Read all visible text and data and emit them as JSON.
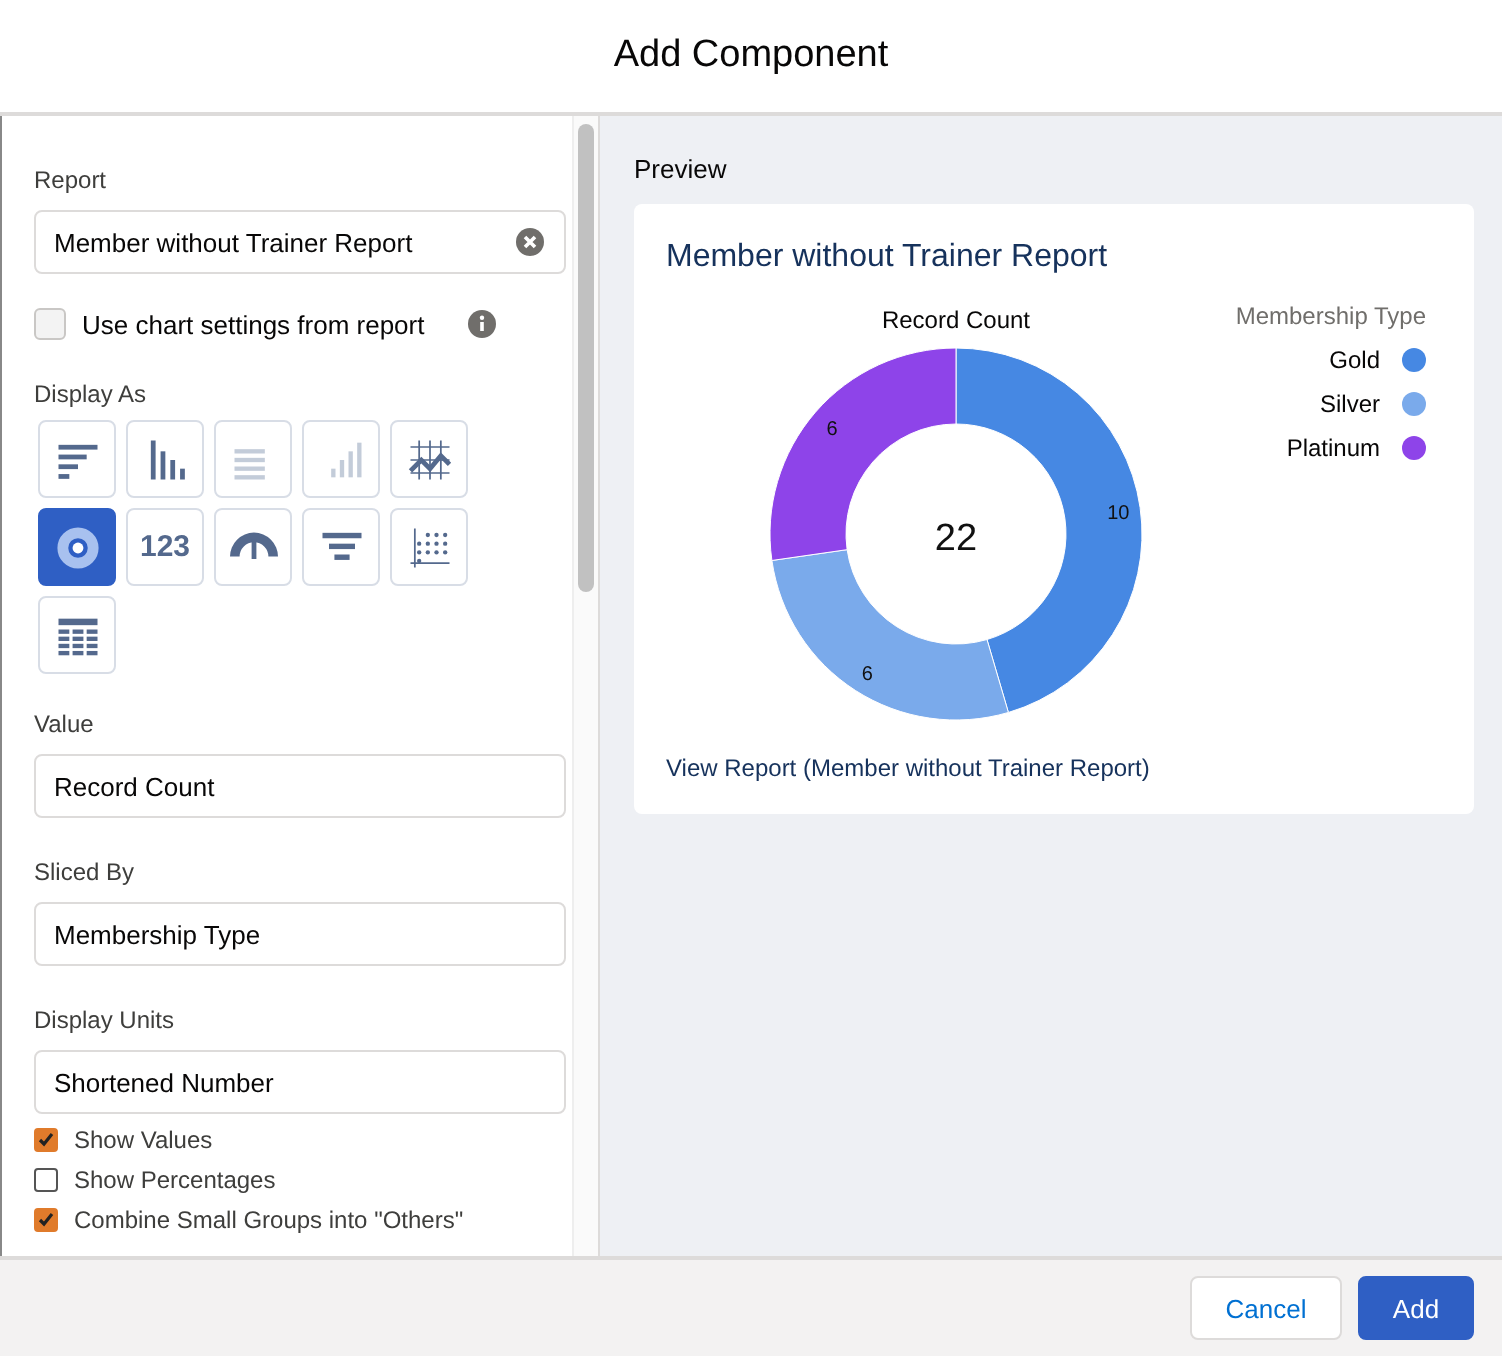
{
  "window": {
    "title": "Add Component"
  },
  "settings": {
    "report": {
      "label": "Report",
      "value": "Member without Trainer Report"
    },
    "use_chart_settings": {
      "label": "Use chart settings from report",
      "checked": false
    },
    "display_as": {
      "label": "Display As",
      "options": [
        {
          "kind": "bar-horizontal",
          "selected": false,
          "disabled": false
        },
        {
          "kind": "bar-vertical",
          "selected": false,
          "disabled": false
        },
        {
          "kind": "stacked-horizontal",
          "selected": false,
          "disabled": true
        },
        {
          "kind": "stacked-vertical",
          "selected": false,
          "disabled": true
        },
        {
          "kind": "line",
          "selected": false,
          "disabled": false
        },
        {
          "kind": "donut",
          "selected": true,
          "disabled": false
        },
        {
          "kind": "metric",
          "selected": false,
          "disabled": false,
          "text": "123"
        },
        {
          "kind": "gauge",
          "selected": false,
          "disabled": false
        },
        {
          "kind": "funnel",
          "selected": false,
          "disabled": false
        },
        {
          "kind": "scatter",
          "selected": false,
          "disabled": false
        },
        {
          "kind": "table",
          "selected": false,
          "disabled": false
        }
      ]
    },
    "fields": [
      {
        "label": "Value",
        "value": "Record Count"
      },
      {
        "label": "Sliced By",
        "value": "Membership Type"
      },
      {
        "label": "Display Units",
        "value": "Shortened Number"
      }
    ],
    "options": [
      {
        "label": "Show Values",
        "checked": true
      },
      {
        "label": "Show Percentages",
        "checked": false
      },
      {
        "label": "Combine Small Groups into \"Others\"",
        "checked": true
      }
    ]
  },
  "preview": {
    "label": "Preview",
    "title": "Member without Trainer Report",
    "total": "22",
    "link": "View Report (Member without Trainer Report)",
    "chart_data": {
      "type": "donut",
      "legend": {
        "title": "Membership Type"
      },
      "categories": [
        "Gold",
        "Silver",
        "Platinum"
      ],
      "series": [
        {
          "name": "Record Count",
          "values": [
            10,
            6,
            6
          ]
        }
      ],
      "colors": [
        "#4688e3",
        "#7aaaeb",
        "#8e44e9"
      ],
      "data_labels": true
    }
  },
  "buttons": [
    {
      "label": "Cancel",
      "kind": "neutral"
    },
    {
      "label": "Add",
      "kind": "brand"
    }
  ]
}
